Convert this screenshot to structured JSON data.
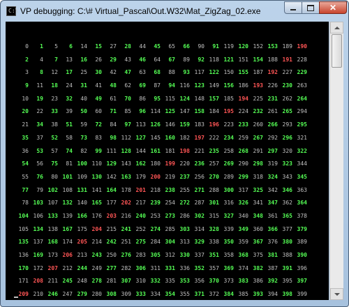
{
  "window": {
    "title": "VP debugging: C:\\# Virtual_Pascal\\Out.W32\\Mat_ZigZag_02.exe",
    "app_icon_glyph": "C:\\",
    "close_glyph": "✕"
  },
  "colors": {
    "gray": "#c0c0c0",
    "green": "#55ff55",
    "red": "#ff5555",
    "background": "#000000"
  },
  "matrix": [
    [
      "0",
      "1",
      "5",
      "6",
      "14",
      "15",
      "27",
      "28",
      "44",
      "45",
      "65",
      "66",
      "90",
      "91",
      "119",
      "120",
      "152",
      "153",
      "189",
      "190"
    ],
    [
      "2",
      "4",
      "7",
      "13",
      "16",
      "26",
      "29",
      "43",
      "46",
      "64",
      "67",
      "89",
      "92",
      "118",
      "121",
      "151",
      "154",
      "188",
      "191",
      "228"
    ],
    [
      "3",
      "8",
      "12",
      "17",
      "25",
      "30",
      "42",
      "47",
      "63",
      "68",
      "88",
      "93",
      "117",
      "122",
      "150",
      "155",
      "187",
      "192",
      "227",
      "229"
    ],
    [
      "9",
      "11",
      "18",
      "24",
      "31",
      "41",
      "48",
      "62",
      "69",
      "87",
      "94",
      "116",
      "123",
      "149",
      "156",
      "186",
      "193",
      "226",
      "230",
      "263"
    ],
    [
      "10",
      "19",
      "23",
      "32",
      "40",
      "49",
      "61",
      "70",
      "86",
      "95",
      "115",
      "124",
      "148",
      "157",
      "185",
      "194",
      "225",
      "231",
      "262",
      "264"
    ],
    [
      "20",
      "22",
      "33",
      "39",
      "50",
      "60",
      "71",
      "85",
      "96",
      "114",
      "125",
      "147",
      "158",
      "184",
      "195",
      "224",
      "232",
      "261",
      "265",
      "294"
    ],
    [
      "21",
      "34",
      "38",
      "51",
      "59",
      "72",
      "84",
      "97",
      "113",
      "126",
      "146",
      "159",
      "183",
      "196",
      "223",
      "233",
      "260",
      "266",
      "293",
      "295"
    ],
    [
      "35",
      "37",
      "52",
      "58",
      "73",
      "83",
      "98",
      "112",
      "127",
      "145",
      "160",
      "182",
      "197",
      "222",
      "234",
      "259",
      "267",
      "292",
      "296",
      "321"
    ],
    [
      "36",
      "53",
      "57",
      "74",
      "82",
      "99",
      "111",
      "128",
      "144",
      "161",
      "181",
      "198",
      "221",
      "235",
      "258",
      "268",
      "291",
      "297",
      "320",
      "322"
    ],
    [
      "54",
      "56",
      "75",
      "81",
      "100",
      "110",
      "129",
      "143",
      "162",
      "180",
      "199",
      "220",
      "236",
      "257",
      "269",
      "290",
      "298",
      "319",
      "323",
      "344"
    ],
    [
      "55",
      "76",
      "80",
      "101",
      "109",
      "130",
      "142",
      "163",
      "179",
      "200",
      "219",
      "237",
      "256",
      "270",
      "289",
      "299",
      "318",
      "324",
      "343",
      "345"
    ],
    [
      "77",
      "79",
      "102",
      "108",
      "131",
      "141",
      "164",
      "178",
      "201",
      "218",
      "238",
      "255",
      "271",
      "288",
      "300",
      "317",
      "325",
      "342",
      "346",
      "363"
    ],
    [
      "78",
      "103",
      "107",
      "132",
      "140",
      "165",
      "177",
      "202",
      "217",
      "239",
      "254",
      "272",
      "287",
      "301",
      "316",
      "326",
      "341",
      "347",
      "362",
      "364"
    ],
    [
      "104",
      "106",
      "133",
      "139",
      "166",
      "176",
      "203",
      "216",
      "240",
      "253",
      "273",
      "286",
      "302",
      "315",
      "327",
      "340",
      "348",
      "361",
      "365",
      "378"
    ],
    [
      "105",
      "134",
      "138",
      "167",
      "175",
      "204",
      "215",
      "241",
      "252",
      "274",
      "285",
      "303",
      "314",
      "328",
      "339",
      "349",
      "360",
      "366",
      "377",
      "379"
    ],
    [
      "135",
      "137",
      "168",
      "174",
      "205",
      "214",
      "242",
      "251",
      "275",
      "284",
      "304",
      "313",
      "329",
      "338",
      "350",
      "359",
      "367",
      "376",
      "380",
      "389"
    ],
    [
      "136",
      "169",
      "173",
      "206",
      "213",
      "243",
      "250",
      "276",
      "283",
      "305",
      "312",
      "330",
      "337",
      "351",
      "358",
      "368",
      "375",
      "381",
      "388",
      "390"
    ],
    [
      "170",
      "172",
      "207",
      "212",
      "244",
      "249",
      "277",
      "282",
      "306",
      "311",
      "331",
      "336",
      "352",
      "357",
      "369",
      "374",
      "382",
      "387",
      "391",
      "396"
    ],
    [
      "171",
      "208",
      "211",
      "245",
      "248",
      "278",
      "281",
      "307",
      "310",
      "332",
      "335",
      "353",
      "356",
      "370",
      "373",
      "383",
      "386",
      "392",
      "395",
      "397"
    ],
    [
      "209",
      "210",
      "246",
      "247",
      "279",
      "280",
      "308",
      "309",
      "333",
      "334",
      "354",
      "355",
      "371",
      "372",
      "384",
      "385",
      "393",
      "394",
      "398",
      "399"
    ]
  ]
}
